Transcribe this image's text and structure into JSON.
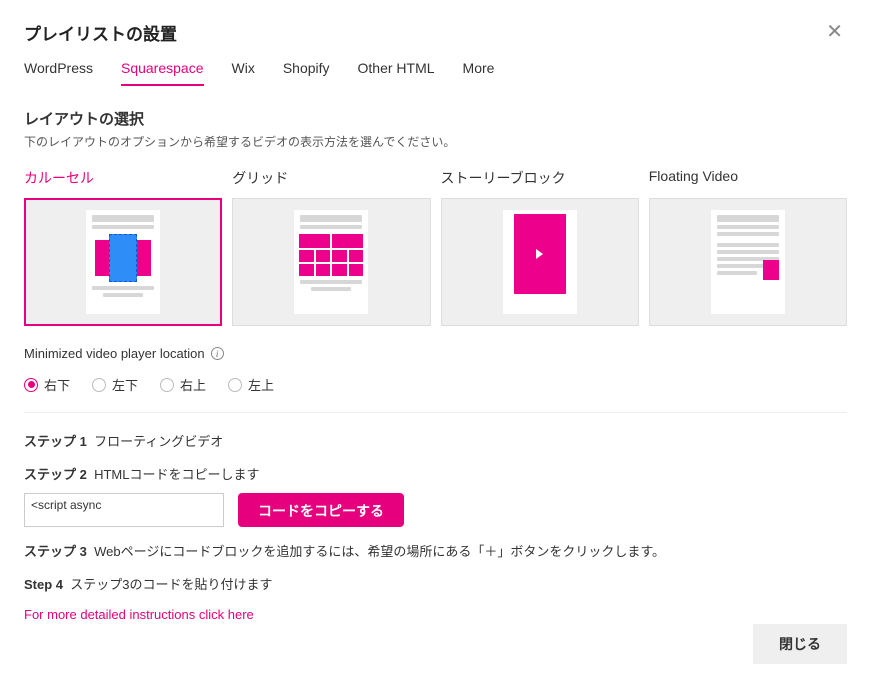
{
  "modal": {
    "title": "プレイリストの設置"
  },
  "tabs": {
    "items": [
      {
        "label": "WordPress"
      },
      {
        "label": "Squarespace"
      },
      {
        "label": "Wix"
      },
      {
        "label": "Shopify"
      },
      {
        "label": "Other HTML"
      },
      {
        "label": "More"
      }
    ],
    "active_index": 1
  },
  "layout_section": {
    "title": "レイアウトの選択",
    "help": "下のレイアウトのオプションから希望するビデオの表示方法を選んでください。"
  },
  "layouts": {
    "items": [
      {
        "label": "カルーセル"
      },
      {
        "label": "グリッド"
      },
      {
        "label": "ストーリーブロック"
      },
      {
        "label": "Floating Video"
      }
    ],
    "selected_index": 0
  },
  "minimized": {
    "label": "Minimized video player location",
    "options": [
      {
        "label": "右下"
      },
      {
        "label": "左下"
      },
      {
        "label": "右上"
      },
      {
        "label": "左上"
      }
    ],
    "selected_index": 0
  },
  "steps": {
    "s1_label": "ステップ 1",
    "s1_text": "フローティングビデオ",
    "s2_label": "ステップ 2",
    "s2_text": "HTMLコードをコピーします",
    "code_snippet": "<script async",
    "copy_button": "コードをコピーする",
    "s3_label": "ステップ 3",
    "s3_text": "Webページにコードブロックを追加するには、希望の場所にある「＋」ボタンをクリックします。",
    "s4_label": "Step 4",
    "s4_text": "ステップ3のコードを貼り付けます",
    "more_link": "For more detailed instructions click here"
  },
  "footer": {
    "close": "閉じる"
  }
}
